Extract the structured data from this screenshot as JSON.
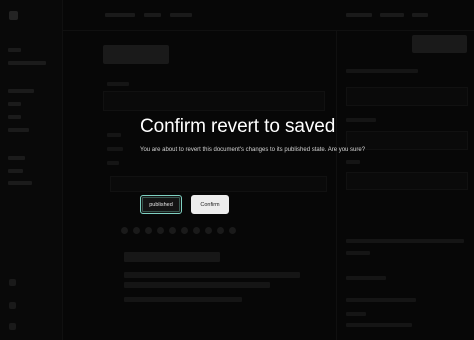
{
  "modal": {
    "title": "Confirm revert to saved",
    "message": "You are about to revert this document's changes to its published state. Are you sure?",
    "cancel_label": "published",
    "confirm_label": "Confirm"
  },
  "colors": {
    "background": "#0c0c0c",
    "focus_ring": "#7fd1c2",
    "confirm_bg": "#ededed"
  }
}
